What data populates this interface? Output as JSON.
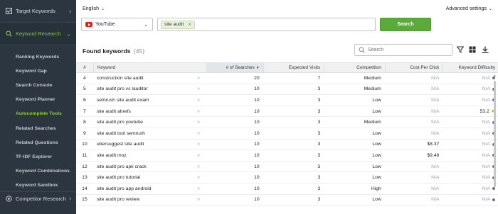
{
  "sidebar": {
    "sections": [
      {
        "label": "Target Keywords",
        "icon": "checkbox-icon",
        "chevron": "›"
      },
      {
        "label": "Keyword Research",
        "icon": "search-icon",
        "chevron": "⌄"
      }
    ],
    "items": [
      {
        "label": "Ranking Keywords"
      },
      {
        "label": "Keyword Gap"
      },
      {
        "label": "Search Console"
      },
      {
        "label": "Keyword Planner"
      },
      {
        "label": "Autocomplete Tools"
      },
      {
        "label": "Related Searches"
      },
      {
        "label": "Related Questions"
      },
      {
        "label": "TF-IDF Explorer"
      },
      {
        "label": "Keyword Combinations"
      },
      {
        "label": "Keyword Sandbox"
      }
    ],
    "bottom_section": {
      "label": "Competitor Research",
      "chevron": "›"
    }
  },
  "header": {
    "language": "English",
    "advanced": "Advanced settings"
  },
  "search": {
    "source": "YouTube",
    "tag": "site audit",
    "button": "Search"
  },
  "results": {
    "title": "Found keywords",
    "count": "(45)",
    "filter_placeholder": "Search"
  },
  "table": {
    "headers": {
      "num": "#",
      "keyword": "Keyword",
      "searches": "# of Searches",
      "visits": "Expected Visits",
      "competition": "Competition",
      "cpc": "Cost Per Click",
      "kd": "Keyword Difficulty"
    },
    "rows": [
      {
        "num": "4",
        "keyword": "construction site audit",
        "searches": "20",
        "visits": "7",
        "competition": "Medium",
        "cpc": "N/A",
        "kd": "N/A"
      },
      {
        "num": "5",
        "keyword": "site audit pro vs lauditor",
        "searches": "10",
        "visits": "3",
        "competition": "Medium",
        "cpc": "N/A",
        "kd": "N/A"
      },
      {
        "num": "6",
        "keyword": "semrush site audit exam",
        "searches": "10",
        "visits": "3",
        "competition": "Low",
        "cpc": "N/A",
        "kd": "N/A"
      },
      {
        "num": "7",
        "keyword": "site audit ahrefs",
        "searches": "10",
        "visits": "3",
        "competition": "Low",
        "cpc": "N/A",
        "kd": "53.2"
      },
      {
        "num": "8",
        "keyword": "site audit pro youtube",
        "searches": "10",
        "visits": "3",
        "competition": "Medium",
        "cpc": "N/A",
        "kd": "N/A"
      },
      {
        "num": "9",
        "keyword": "site audit tool semrush",
        "searches": "10",
        "visits": "3",
        "competition": "Low",
        "cpc": "N/A",
        "kd": "N/A"
      },
      {
        "num": "10",
        "keyword": "ubersuggest site audit",
        "searches": "10",
        "visits": "3",
        "competition": "Low",
        "cpc": "$8.37",
        "kd": "N/A"
      },
      {
        "num": "11",
        "keyword": "site audit moz",
        "searches": "10",
        "visits": "3",
        "competition": "Low",
        "cpc": "$9.46",
        "kd": "N/A"
      },
      {
        "num": "12",
        "keyword": "site audit pro apk crack",
        "searches": "10",
        "visits": "3",
        "competition": "Low",
        "cpc": "N/A",
        "kd": "N/A"
      },
      {
        "num": "13",
        "keyword": "site audit pro tutorial",
        "searches": "10",
        "visits": "3",
        "competition": "Low",
        "cpc": "N/A",
        "kd": "N/A"
      },
      {
        "num": "14",
        "keyword": "site audit pro app android",
        "searches": "10",
        "visits": "3",
        "competition": "High",
        "cpc": "N/A",
        "kd": "N/A"
      },
      {
        "num": "15",
        "keyword": "site audit pro review",
        "searches": "10",
        "visits": "3",
        "competition": "Low",
        "cpc": "N/A",
        "kd": "N/A"
      }
    ]
  },
  "colors": {
    "sidebar_bg": "#2c3640",
    "accent_green": "#8cc63f",
    "button_green": "#5bab3b",
    "youtube_red": "#e62117"
  }
}
